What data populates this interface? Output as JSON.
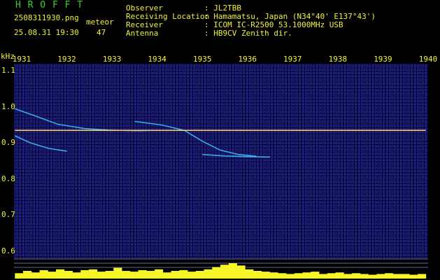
{
  "header": {
    "app_name": "H R O F F T",
    "filename": "2508311930.png",
    "mode": "meteor",
    "datetime": "25.08.31 19:30",
    "count": "47",
    "info": [
      {
        "label": "Observer",
        "value": ": JL2TBB"
      },
      {
        "label": "Receiving Location",
        "value": ": Hamamatsu, Japan (N34°40' E137°43')"
      },
      {
        "label": "Receiver",
        "value": ": ICOM IC-R2500 53.1000MHz USB"
      },
      {
        "label": "Antenna",
        "value": ": HB9CV Zenith dir."
      }
    ]
  },
  "colors": {
    "background": "#0a0a40",
    "label_yellow": "#f2f23a",
    "title_green": "#33d42b",
    "carrier": "#ffd060",
    "meteor_cyan": "#40c8ff",
    "bottom_bars": "#f5f52a"
  },
  "chart_data": {
    "type": "heatmap",
    "ylabel": "kHz",
    "x_ticks": [
      "1931",
      "1932",
      "1933",
      "1934",
      "1935",
      "1936",
      "1937",
      "1938",
      "1939",
      "1940"
    ],
    "y_ticks": [
      "1.1",
      "1.0",
      "0.9",
      "0.8",
      "0.7",
      "0.6"
    ],
    "xlim": [
      1930.83,
      1940.0
    ],
    "ylim": [
      0.58,
      1.12
    ],
    "carrier": {
      "x": [
        1930.85,
        1939.95
      ],
      "y": [
        0.935,
        0.935
      ]
    },
    "traces": [
      {
        "x": [
          1930.85,
          1931.3,
          1931.8,
          1932.4,
          1932.9
        ],
        "y": [
          0.995,
          0.975,
          0.952,
          0.94,
          0.936
        ]
      },
      {
        "x": [
          1930.85,
          1931.2,
          1931.6,
          1932.0
        ],
        "y": [
          0.92,
          0.9,
          0.885,
          0.877
        ]
      },
      {
        "x": [
          1932.8,
          1933.2,
          1933.6,
          1933.9
        ],
        "y": [
          0.936,
          0.935,
          0.934,
          0.935
        ]
      },
      {
        "x": [
          1933.5,
          1934.1,
          1934.6,
          1935.0,
          1935.4,
          1935.8,
          1936.2
        ],
        "y": [
          0.96,
          0.95,
          0.935,
          0.905,
          0.88,
          0.868,
          0.863
        ]
      },
      {
        "x": [
          1935.0,
          1935.5,
          1936.0,
          1936.5
        ],
        "y": [
          0.868,
          0.864,
          0.862,
          0.861
        ]
      }
    ],
    "power_bars": {
      "x_start": 1930.85,
      "x_end": 1939.95,
      "values": [
        0.35,
        0.5,
        0.4,
        0.55,
        0.45,
        0.6,
        0.5,
        0.4,
        0.55,
        0.6,
        0.45,
        0.5,
        0.7,
        0.5,
        0.45,
        0.55,
        0.5,
        0.6,
        0.4,
        0.5,
        0.55,
        0.45,
        0.5,
        0.6,
        0.75,
        0.9,
        1.0,
        0.85,
        0.6,
        0.5,
        0.45,
        0.4,
        0.35,
        0.3,
        0.35,
        0.4,
        0.45,
        0.3,
        0.35,
        0.4,
        0.3,
        0.35,
        0.3,
        0.25,
        0.3,
        0.35,
        0.3,
        0.3,
        0.25,
        0.3
      ]
    },
    "grid": false
  }
}
